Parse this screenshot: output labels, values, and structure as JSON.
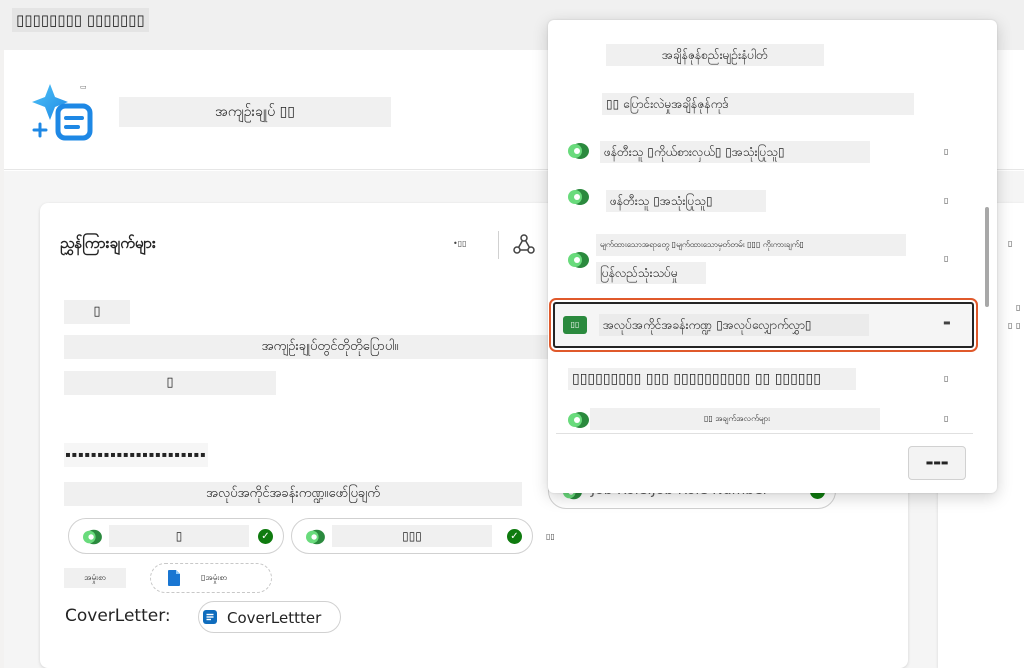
{
  "app": {
    "title": "▯▯▯▯▯▯▯▯ ▯▯▯▯▯▯▯"
  },
  "agent": {
    "name": "အကျဉ်းချုပ် ▯▯",
    "icon_tag": "▭",
    "icon": "copilot-sparkle-doc-icon"
  },
  "card": {
    "title": "ညွှန်ကြားချက်များ",
    "tag": "•▯▯",
    "empty_block": "▯",
    "instruction": "အကျဉ်းချုပ်တွင်တိုတိုပြောပါ။",
    "block_mid": "▯",
    "dots": "▪▪▪▪▪▪▪▪▪▪▪▪▪▪▪▪▪▪▪▪▪▪",
    "jobrole_line": "အလုပ်အကိုင်အခန်းကဏ္ဍ။ဖော်ပြချက်",
    "pill1": "▯",
    "pill2": "▯▯▯",
    "pill_tag": "▯▯",
    "doc_label": "အမှုံးစာ",
    "doc_pill_text": "▯အမှုံးစာ",
    "cover_label": "CoverLetter:",
    "cover_pill_text": "CoverLettter",
    "bg_pill_text": "Job Role.Job Role Number"
  },
  "dropdown": {
    "heading1": "အချိန်ဇုန်စည်းမျဉ်းနံပါတ်",
    "heading2": "▯▯ ပြောင်းလဲမှုအချိန်ဇုန်ကုဒ်",
    "items": [
      {
        "label": "ဖန်တီးသူ ▯ကိုယ်စားလှယ်▯ ▯အသုံးပြုသူ▯",
        "tag": "▯"
      },
      {
        "label": "ဖန်တီးသူ ▯အသုံးပြုသူ▯",
        "tag": "▯",
        "prefix": "▯"
      },
      {
        "label": "မျက်ထားသောအရာတွေ ▯မျက်ထားသောမှတ်တမ်း ▯▯▯ ကိုးကားချက်▯",
        "label2": "ပြန်လည်သုံးသပ်မှု",
        "tag": "▯"
      },
      {
        "label": "အလုပ်အကိုင်အခန်းကဏ္ဍ ▯အလုပ်လျှောက်လွှာ▯",
        "tag": "▬",
        "icon_text": "▯▯"
      },
      {
        "label": "▯▯▯▯▯▯▯▯▯ ▯▯▯ ▯▯▯▯▯▯▯▯▯▯ ▯▯ ▯▯▯▯▯▯",
        "tag": "▯"
      },
      {
        "label": "▯▯ အချက်အလက်များ",
        "tag": "▯"
      }
    ],
    "button_label": "▬▬▬"
  },
  "right_panel": {
    "tags": [
      "▯",
      "▯",
      "▯",
      "▯"
    ]
  },
  "colors": {
    "accent_orange": "#e0592b",
    "check_green": "#0f7b0f",
    "dataverse_green": "#2b8a3e",
    "brand_blue": "#1976d2"
  }
}
